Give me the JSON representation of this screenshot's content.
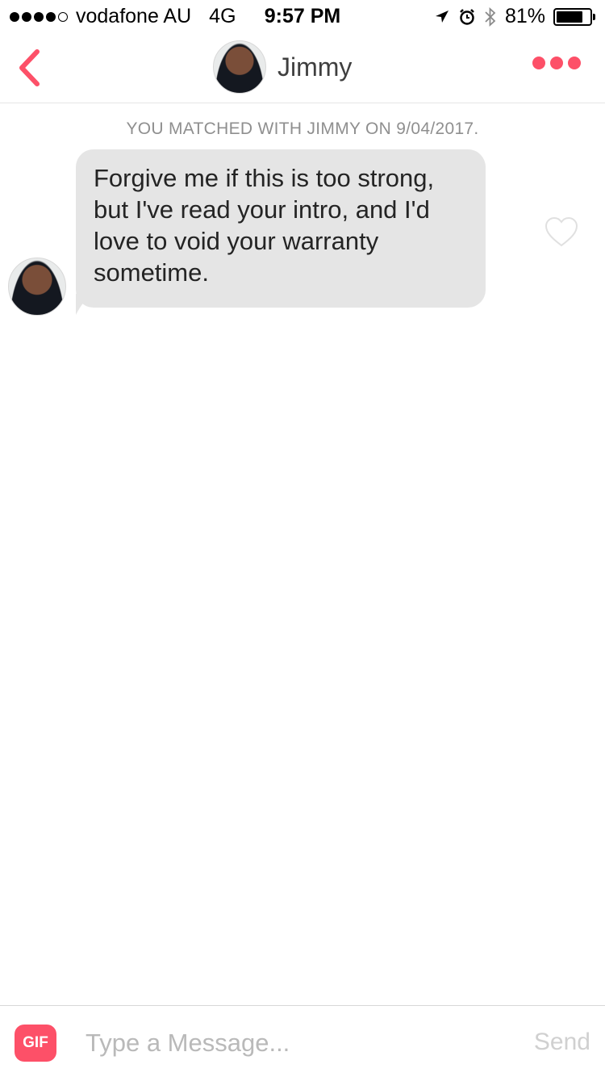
{
  "status_bar": {
    "carrier": "vodafone AU",
    "network": "4G",
    "time": "9:57 PM",
    "battery_percent": "81%",
    "battery_level": 0.81,
    "icons": [
      "signal-dots",
      "location-arrow-icon",
      "alarm-icon",
      "bluetooth-icon",
      "battery-icon"
    ]
  },
  "header": {
    "back_icon": "chevron-left-icon",
    "contact_name": "Jimmy",
    "more_icon": "more-dots-icon",
    "accent_color": "#fd5068"
  },
  "chat": {
    "match_notice": "YOU MATCHED WITH JIMMY ON 9/04/2017.",
    "messages": [
      {
        "sender": "Jimmy",
        "text": "Forgive me if this is too strong, but I've read your intro, and I'd love to void your warranty sometime.",
        "bubble_color": "#e5e5e5",
        "like_icon": "heart-outline-icon"
      }
    ]
  },
  "composer": {
    "gif_label": "GIF",
    "placeholder": "Type a Message...",
    "send_label": "Send"
  }
}
